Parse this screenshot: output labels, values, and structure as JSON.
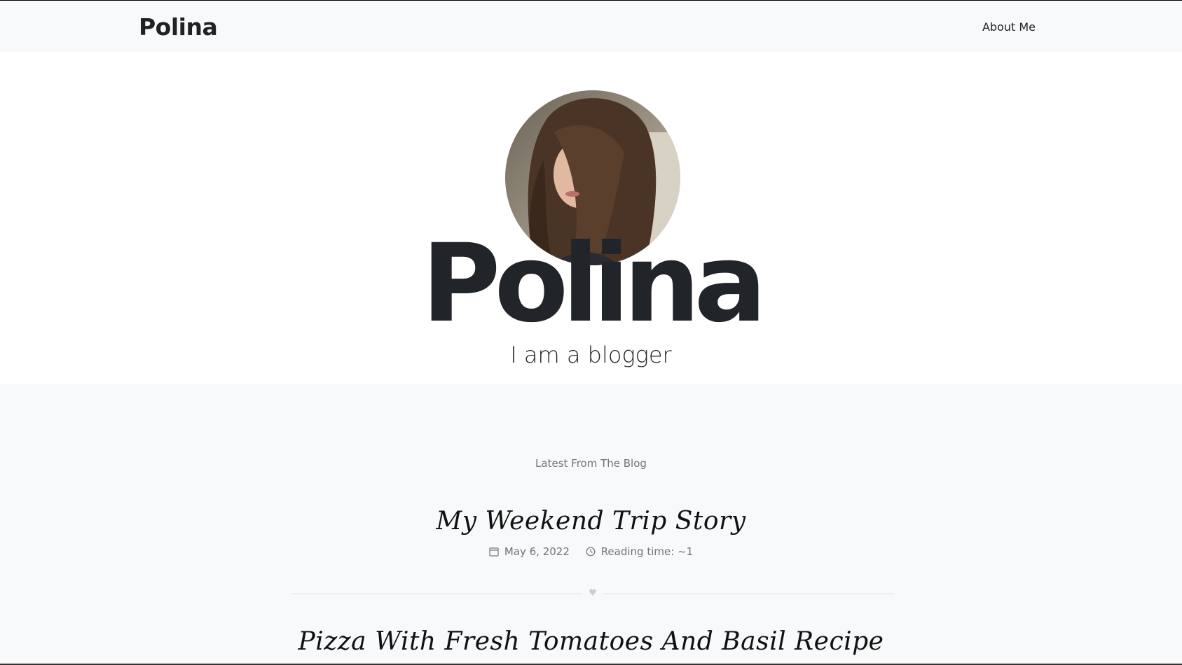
{
  "navbar": {
    "brand": "Polina",
    "links": [
      {
        "label": "About Me"
      }
    ]
  },
  "hero": {
    "name": "Polina",
    "tagline": "I am a blogger"
  },
  "blog": {
    "section_label": "Latest From The Blog",
    "posts": [
      {
        "title": "My Weekend Trip Story",
        "date": "May 6, 2022",
        "reading_time": "Reading time: ~1"
      },
      {
        "title": "Pizza With Fresh Tomatoes And Basil Recipe"
      }
    ]
  },
  "icons": {
    "date": "calendar-icon",
    "reading_time": "clock-icon",
    "divider": "heart-icon"
  }
}
